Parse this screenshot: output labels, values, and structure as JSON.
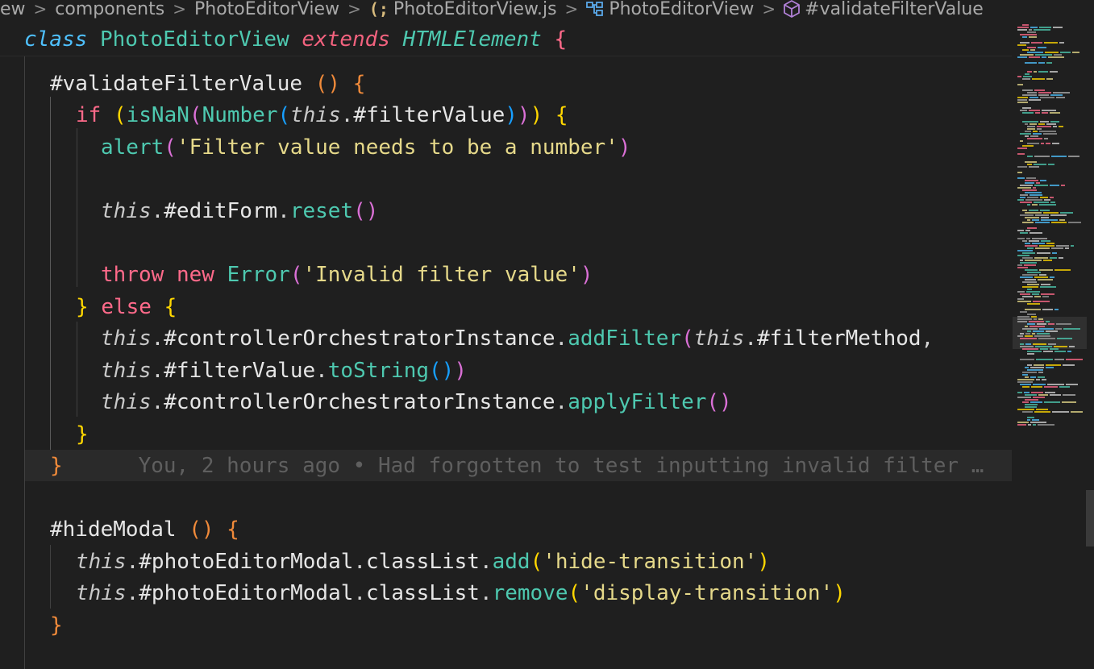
{
  "breadcrumb": {
    "items": [
      {
        "label": "ew",
        "icon": null
      },
      {
        "label": "components",
        "icon": null
      },
      {
        "label": "PhotoEditorView",
        "icon": null
      },
      {
        "label": "PhotoEditorView.js",
        "icon": "js-braces-icon"
      },
      {
        "label": "PhotoEditorView",
        "icon": "class-icon"
      },
      {
        "label": "#validateFilterValue",
        "icon": "method-cube-icon"
      }
    ],
    "separator": ">"
  },
  "code": {
    "class_kw": "class",
    "class_name": "PhotoEditorView",
    "extends_kw": "extends",
    "base_class": "HTMLElement",
    "method1": "#validateFilterValue",
    "method2": "#hideModal",
    "if_kw": "if",
    "isNaN": "isNaN",
    "Number": "Number",
    "this_kw": "this",
    "filterValue": "#filterValue",
    "alert_fn": "alert",
    "alert_msg": "'Filter value needs to be a number'",
    "editForm": "#editForm",
    "reset_fn": "reset",
    "throw_kw": "throw",
    "new_kw": "new",
    "error_cls": "Error",
    "error_msg": "'Invalid filter value'",
    "else_kw": "else",
    "controller": "#controllerOrchestratorInstance",
    "addFilter": "addFilter",
    "filterMethod": "#filterMethod",
    "toString": "toString",
    "applyFilter": "applyFilter",
    "photoModal": "#photoEditorModal",
    "classList": "classList",
    "add_fn": "add",
    "remove_fn": "remove",
    "hide_str": "'hide-transition'",
    "display_str": "'display-transition'",
    "blame": "You, 2 hours ago • Had forgotten to test inputting invalid filter …"
  },
  "colors": {
    "background": "#1f1f1f",
    "current_line": "#2a2a2a",
    "bracket_gold": "#ffd700",
    "bracket_orange": "#f08a3a",
    "string": "#e6d98a",
    "keyword_control": "#ff6a8a",
    "class_name": "#4ec9b0"
  }
}
